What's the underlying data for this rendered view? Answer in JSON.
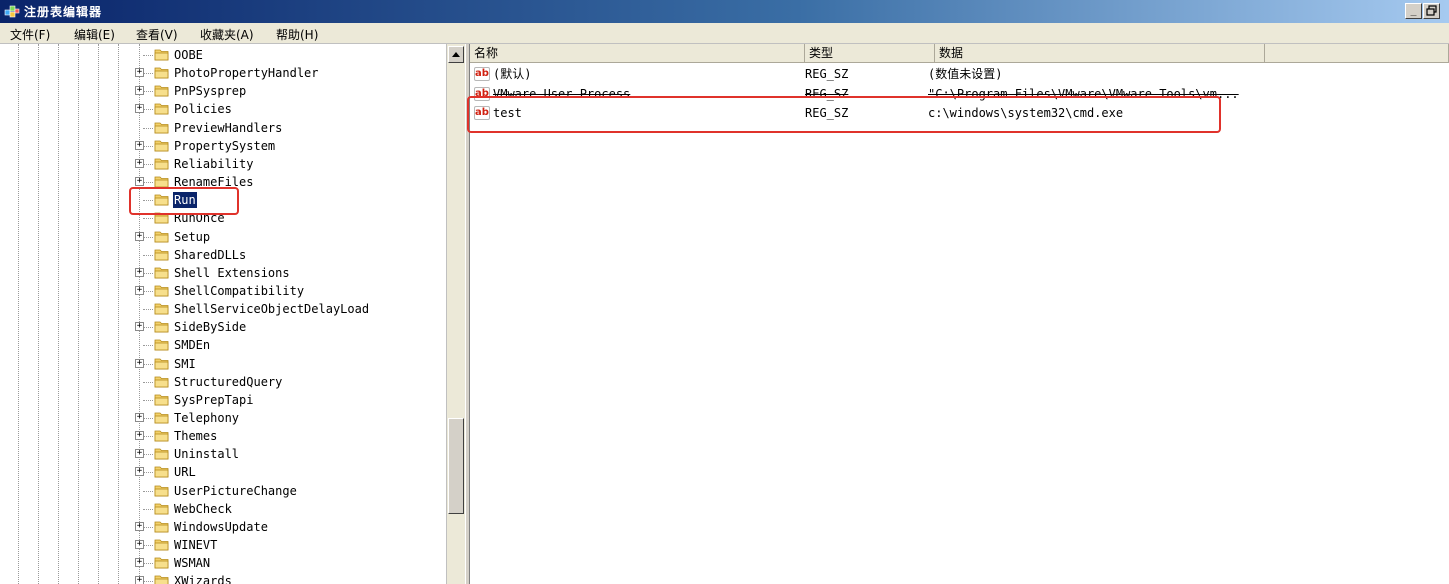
{
  "window": {
    "title": "注册表编辑器",
    "buttons": {
      "minimize": "_",
      "restore": "🗗"
    }
  },
  "menubar": {
    "items": [
      "文件(F)",
      "编辑(E)",
      "查看(V)",
      "收藏夹(A)",
      "帮助(H)"
    ]
  },
  "tree": {
    "items": [
      {
        "label": "OOBE",
        "expandable": false,
        "selected": false
      },
      {
        "label": "PhotoPropertyHandler",
        "expandable": true,
        "selected": false
      },
      {
        "label": "PnPSysprep",
        "expandable": true,
        "selected": false
      },
      {
        "label": "Policies",
        "expandable": true,
        "selected": false
      },
      {
        "label": "PreviewHandlers",
        "expandable": false,
        "selected": false
      },
      {
        "label": "PropertySystem",
        "expandable": true,
        "selected": false
      },
      {
        "label": "Reliability",
        "expandable": true,
        "selected": false
      },
      {
        "label": "RenameFiles",
        "expandable": true,
        "selected": false
      },
      {
        "label": "Run",
        "expandable": false,
        "selected": true
      },
      {
        "label": "RunOnce",
        "expandable": false,
        "selected": false
      },
      {
        "label": "Setup",
        "expandable": true,
        "selected": false
      },
      {
        "label": "SharedDLLs",
        "expandable": false,
        "selected": false
      },
      {
        "label": "Shell Extensions",
        "expandable": true,
        "selected": false
      },
      {
        "label": "ShellCompatibility",
        "expandable": true,
        "selected": false
      },
      {
        "label": "ShellServiceObjectDelayLoad",
        "expandable": false,
        "selected": false
      },
      {
        "label": "SideBySide",
        "expandable": true,
        "selected": false
      },
      {
        "label": "SMDEn",
        "expandable": false,
        "selected": false
      },
      {
        "label": "SMI",
        "expandable": true,
        "selected": false
      },
      {
        "label": "StructuredQuery",
        "expandable": false,
        "selected": false
      },
      {
        "label": "SysPrepTapi",
        "expandable": false,
        "selected": false
      },
      {
        "label": "Telephony",
        "expandable": true,
        "selected": false
      },
      {
        "label": "Themes",
        "expandable": true,
        "selected": false
      },
      {
        "label": "Uninstall",
        "expandable": true,
        "selected": false
      },
      {
        "label": "URL",
        "expandable": true,
        "selected": false
      },
      {
        "label": "UserPictureChange",
        "expandable": false,
        "selected": false
      },
      {
        "label": "WebCheck",
        "expandable": false,
        "selected": false
      },
      {
        "label": "WindowsUpdate",
        "expandable": true,
        "selected": false
      },
      {
        "label": "WINEVT",
        "expandable": true,
        "selected": false
      },
      {
        "label": "WSMAN",
        "expandable": true,
        "selected": false
      },
      {
        "label": "XWizards",
        "expandable": true,
        "selected": false
      }
    ]
  },
  "list": {
    "columns": [
      "名称",
      "类型",
      "数据"
    ],
    "rows": [
      {
        "name": "(默认)",
        "type": "REG_SZ",
        "data": "(数值未设置)",
        "struck": false
      },
      {
        "name": "VMware User Process",
        "type": "REG_SZ",
        "data": "\"C:\\Program Files\\VMware\\VMware Tools\\vm...",
        "struck": true
      },
      {
        "name": "test",
        "type": "REG_SZ",
        "data": "c:\\windows\\system32\\cmd.exe",
        "struck": false
      }
    ]
  },
  "colors": {
    "highlight_box": "#e0322b",
    "selection": "#0a246a",
    "value_icon": "#d02010"
  }
}
